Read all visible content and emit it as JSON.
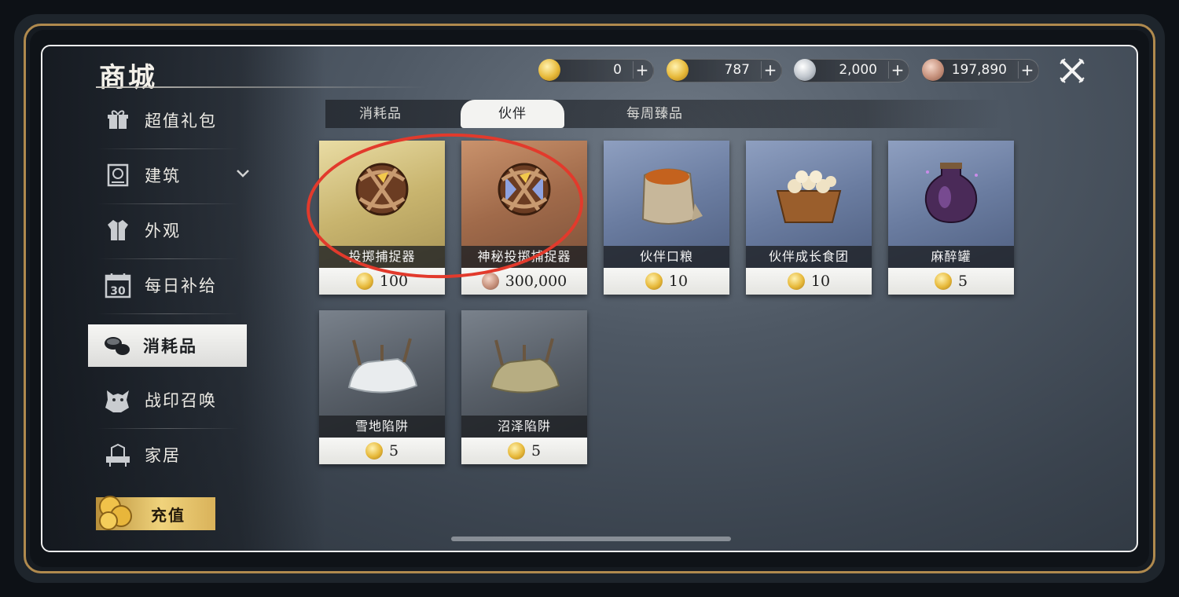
{
  "header": {
    "title": "商城"
  },
  "currencies": [
    {
      "icon": "gold-coin-icon",
      "value": "0"
    },
    {
      "icon": "gold-coin-icon",
      "value": "787"
    },
    {
      "icon": "silver-coin-icon",
      "value": "2,000"
    },
    {
      "icon": "copper-coin-icon",
      "value": "197,890"
    }
  ],
  "sidebar": {
    "items": [
      {
        "label": "超值礼包",
        "icon": "gift-pack-icon"
      },
      {
        "label": "建筑",
        "icon": "building-icon"
      },
      {
        "label": "外观",
        "icon": "outfit-icon"
      },
      {
        "label": "每日补给",
        "icon": "calendar-icon",
        "icon_text": "30"
      },
      {
        "label": "消耗品",
        "icon": "consumables-icon"
      },
      {
        "label": "战印召唤",
        "icon": "wolf-icon"
      },
      {
        "label": "家居",
        "icon": "furniture-icon"
      }
    ],
    "active": "消耗品",
    "recharge_label": "充值"
  },
  "tabs": [
    {
      "label": "消耗品"
    },
    {
      "label": "伙伴"
    },
    {
      "label": "每周臻品"
    }
  ],
  "active_tab": "伙伴",
  "items": [
    {
      "name": "投掷捕捉器",
      "price": "100",
      "currency": "gold-coin-icon",
      "icon": "capture-ball-icon"
    },
    {
      "name": "神秘投掷捕捉器",
      "price": "300,000",
      "currency": "copper-coin-icon",
      "icon": "mystery-capture-ball-icon"
    },
    {
      "name": "伙伴口粮",
      "price": "10",
      "currency": "gold-coin-icon",
      "icon": "grain-sack-icon"
    },
    {
      "name": "伙伴成长食团",
      "price": "10",
      "currency": "gold-coin-icon",
      "icon": "food-basket-icon"
    },
    {
      "name": "麻醉罐",
      "price": "5",
      "currency": "gold-coin-icon",
      "icon": "potion-jar-icon"
    },
    {
      "name": "雪地陷阱",
      "price": "5",
      "currency": "gold-coin-icon",
      "icon": "snow-trap-icon"
    },
    {
      "name": "沼泽陷阱",
      "price": "5",
      "currency": "gold-coin-icon",
      "icon": "swamp-trap-icon"
    }
  ],
  "colors": {
    "highlight_circle": "#e23a2c",
    "gold": "#e7b93a",
    "active_bg": "#f3f3f1"
  }
}
